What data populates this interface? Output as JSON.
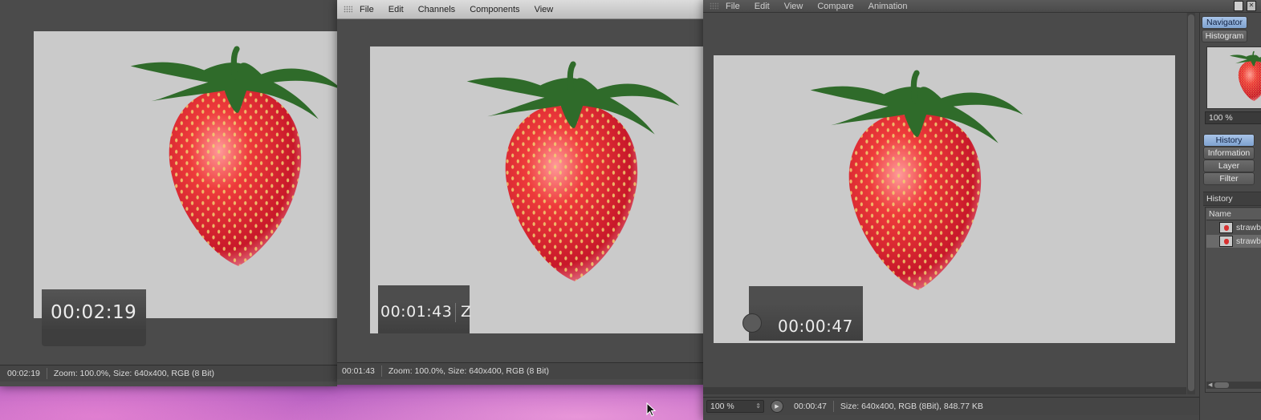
{
  "window1": {
    "timer": "00:02:19",
    "status": {
      "time": "00:02:19",
      "info": "Zoom: 100.0%, Size: 640x400, RGB (8 Bit)"
    }
  },
  "window2": {
    "menu": [
      "File",
      "Edit",
      "Channels",
      "Components",
      "View"
    ],
    "timer": "00:01:43",
    "timer_tail": "Z",
    "status": {
      "time": "00:01:43",
      "info": "Zoom: 100.0%, Size: 640x400, RGB (8 Bit)"
    }
  },
  "window3": {
    "menu": [
      "File",
      "Edit",
      "View",
      "Compare",
      "Animation"
    ],
    "timer": "00:00:47",
    "status": {
      "zoom": "100 %",
      "time": "00:00:47",
      "info": "Size: 640x400, RGB (8Bit), 848.77 KB"
    }
  },
  "sidebar": {
    "top_tabs": [
      "Navigator",
      "Histogram"
    ],
    "navigator_zoom": "100 %",
    "tabs": [
      "History",
      "Information",
      "Layer",
      "Filter"
    ],
    "history_title": "History",
    "column_header": "Name",
    "history_items": [
      "strawb",
      "strawb"
    ]
  },
  "colors": {
    "accent": "#8fb3df",
    "canvas": "#cacaca",
    "panel": "#4b4b4b"
  },
  "icons": [
    "window-grip-icon",
    "play-icon",
    "zoom-stepper-icon",
    "panel-toggle-icon",
    "close-icon",
    "mouse-cursor-icon"
  ]
}
